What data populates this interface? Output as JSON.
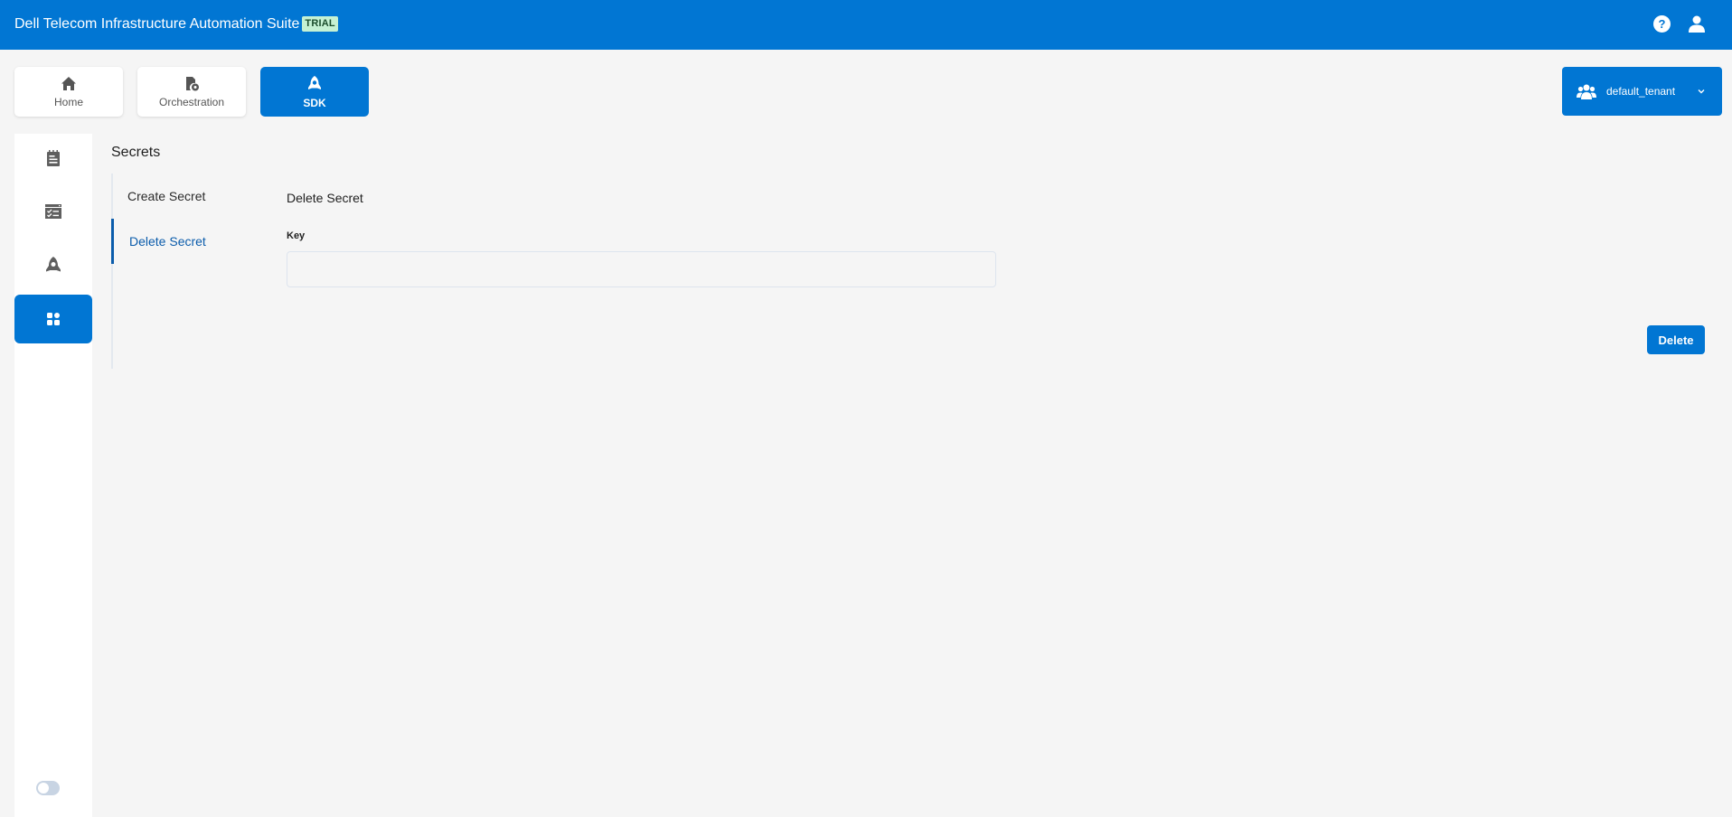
{
  "header": {
    "app_title": "Dell Telecom Infrastructure Automation Suite",
    "badge": "TRIAL",
    "help_icon": "?",
    "icons": [
      "help-icon",
      "user-icon"
    ]
  },
  "top_nav": {
    "items": [
      {
        "label": "Home",
        "icon": "home-icon",
        "active": false
      },
      {
        "label": "Orchestration",
        "icon": "orchestration-gear-file-icon",
        "active": false
      },
      {
        "label": "SDK",
        "icon": "rocket-icon",
        "active": true
      }
    ]
  },
  "tenant": {
    "name": "default_tenant",
    "icon": "users-icon"
  },
  "sidebar": {
    "items": [
      {
        "icon": "notepad-icon",
        "active": false
      },
      {
        "icon": "checklist-icon",
        "active": false
      },
      {
        "icon": "rocket-icon",
        "active": false
      },
      {
        "icon": "grid-apps-icon",
        "active": true
      }
    ],
    "theme_toggle": {
      "on": false
    }
  },
  "page": {
    "title": "Secrets",
    "subnav": [
      {
        "label": "Create Secret",
        "active": false
      },
      {
        "label": "Delete Secret",
        "active": true
      }
    ],
    "form": {
      "title": "Delete Secret",
      "key_label": "Key",
      "key_value": "",
      "key_placeholder": "",
      "submit_label": "Delete"
    }
  },
  "colors": {
    "brand_blue": "#0176d3",
    "active_text": "#0b5cab",
    "badge_bg": "#c5f1d3",
    "badge_text": "#1b4d2c",
    "background": "#f5f5f5"
  }
}
